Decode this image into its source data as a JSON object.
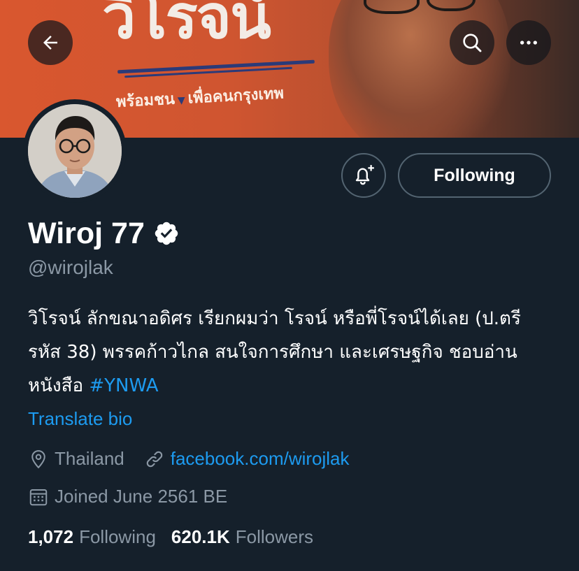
{
  "banner": {
    "title": "วิโรจน์",
    "tagline_left": "พร้อมชน",
    "tagline_sep": "▼",
    "tagline_right": "เพื่อคนกรุงเทพ"
  },
  "nav": {
    "back_icon": "arrow-left-icon",
    "search_icon": "search-icon",
    "more_icon": "more-horizontal-icon"
  },
  "profile": {
    "display_name": "Wiroj 77",
    "verified": true,
    "handle": "@wirojlak",
    "bio_text": "วิโรจน์ ลักขณาอดิศร เรียกผมว่า โรจน์ หรือพี่โรจน์ได้เลย (ป.ตรี รหัส 38) พรรคก้าวไกล สนใจการศึกษา และเศรษฐกิจ ชอบอ่านหนังสือ ",
    "bio_hashtag": "#YNWA",
    "translate_label": "Translate bio",
    "location": "Thailand",
    "website": "facebook.com/wirojlak",
    "joined": "Joined June 2561 BE"
  },
  "actions": {
    "following_label": "Following",
    "notify_icon": "bell-plus-icon"
  },
  "stats": {
    "following_count": "1,072",
    "following_label": "Following",
    "followers_count": "620.1K",
    "followers_label": "Followers"
  },
  "colors": {
    "background": "#15202b",
    "accent": "#1d9bf0",
    "muted": "#8b98a5",
    "banner": "#d9572f"
  }
}
